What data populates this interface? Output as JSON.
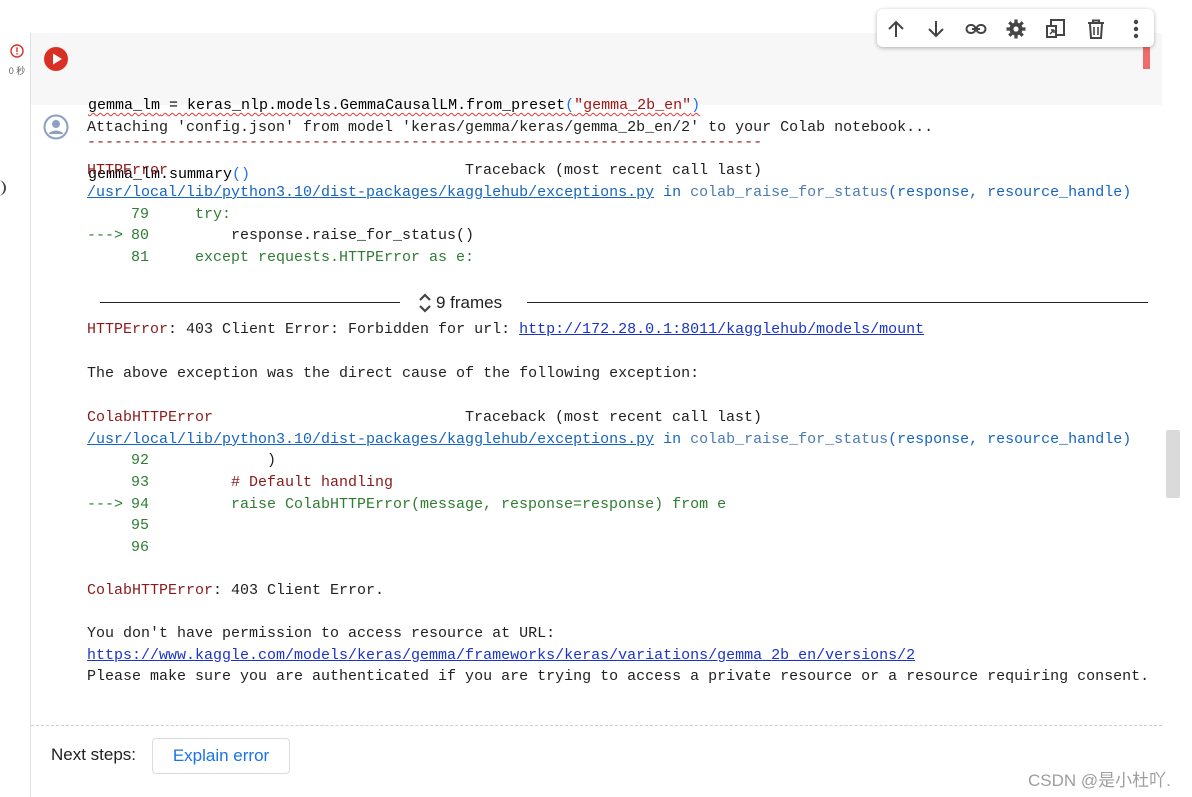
{
  "cell": {
    "status_time": "0 秒",
    "code_line1": {
      "var": "gemma_lm",
      "op": " = ",
      "call": "keras_nlp.models.GemmaCausalLM.from_preset",
      "open": "(",
      "arg": "\"gemma_2b_en\"",
      "close": ")"
    },
    "code_line2": {
      "text": "gemma_lm.summary",
      "parens": "()"
    }
  },
  "toolbar": {
    "icons": [
      "arrow-up-icon",
      "arrow-down-icon",
      "link-icon",
      "gear-icon",
      "mirror-cell-icon",
      "trash-icon",
      "more-vert-icon"
    ]
  },
  "output": {
    "attach_line": "Attaching 'config.json' from model 'keras/gemma/keras/gemma_2b_en/2' to your Colab notebook...",
    "dash_line": "---------------------------------------------------------------------------",
    "tb1": {
      "error_name": "HTTPError",
      "traceback_label": "Traceback (most recent call last)",
      "file_path": "/usr/local/lib/python3.10/dist-packages/kagglehub/exceptions.py",
      "in_word": " in ",
      "func": "colab_raise_for_status",
      "args": "(response, resource_handle)",
      "lines": [
        {
          "num": "79",
          "arrow": "",
          "code": "try:"
        },
        {
          "num": "80",
          "arrow": "--->",
          "code": "response.raise_for_status()"
        },
        {
          "num": "81",
          "arrow": "",
          "code": "except requests.HTTPError as e:"
        }
      ]
    },
    "frames_label": "9 frames",
    "http_error": {
      "prefix": "HTTPError",
      "msg": ": 403 Client Error: Forbidden for url: ",
      "url": "http://172.28.0.1:8011/kagglehub/models/mount"
    },
    "cause_line": "The above exception was the direct cause of the following exception:",
    "tb2": {
      "error_name": "ColabHTTPError",
      "traceback_label": "Traceback (most recent call last)",
      "file_path": "/usr/local/lib/python3.10/dist-packages/kagglehub/exceptions.py",
      "in_word": " in ",
      "func": "colab_raise_for_status",
      "args": "(response, resource_handle)",
      "lines": [
        {
          "num": "92",
          "arrow": "",
          "code": ")"
        },
        {
          "num": "93",
          "arrow": "",
          "code": "# Default handling"
        },
        {
          "num": "94",
          "arrow": "--->",
          "code": "raise ColabHTTPError(message, response=response) from e"
        },
        {
          "num": "95",
          "arrow": "",
          "code": ""
        },
        {
          "num": "96",
          "arrow": "",
          "code": ""
        }
      ]
    },
    "final_error": {
      "prefix": "ColabHTTPError",
      "msg": ": 403 Client Error."
    },
    "permission_line": "You don't have permission to access resource at URL:",
    "resource_url": "https://www.kaggle.com/models/keras/gemma/frameworks/keras/variations/gemma_2b_en/versions/2",
    "auth_line": "Please make sure you are authenticated if you are trying to access a private resource or a resource requiring consent."
  },
  "next_steps": {
    "label": "Next steps:",
    "button": "Explain error"
  },
  "watermark": "CSDN @是小杜吖.",
  "colors": {
    "error_red": "#8b1a1a",
    "link_blue": "#1a33c8",
    "accent_blue": "#1a73e8",
    "run_red": "#d93025"
  }
}
